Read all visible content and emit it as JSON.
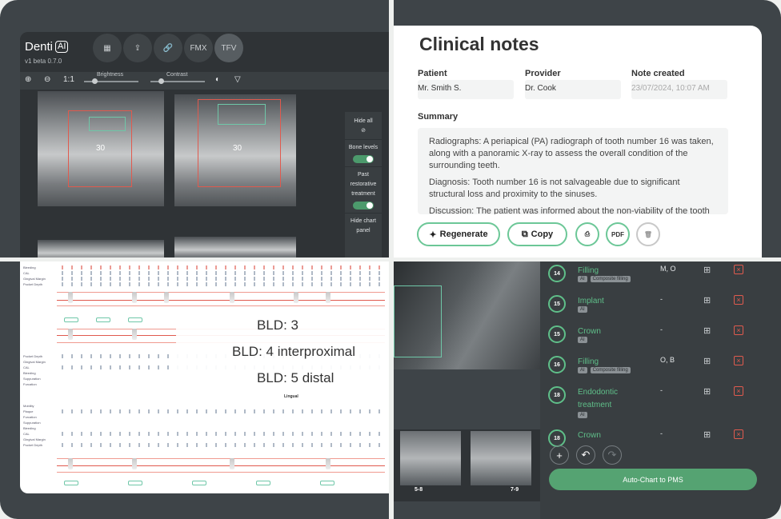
{
  "app": {
    "logo": "Denti",
    "logo_badge": "AI",
    "version": "v1 beta 0.7.0"
  },
  "toolbar": {
    "fmx": "FMX",
    "tfv": "TFV",
    "zoom_in": "⊕",
    "zoom_out": "⊖",
    "one_to_one": "1:1",
    "brightness": "Brightness",
    "contrast": "Contrast"
  },
  "xrays": {
    "label_a": "30",
    "label_b": "30"
  },
  "side_panel": {
    "hide_all": "Hide all",
    "bone_levels": "Bone levels",
    "past_treatment": "Past restorative treatment",
    "hide_chart": "Hide chart panel"
  },
  "notes": {
    "title": "Clinical notes",
    "patient_label": "Patient",
    "patient_value": "Mr. Smith S.",
    "provider_label": "Provider",
    "provider_value": "Dr. Cook",
    "created_label": "Note created",
    "created_value": "23/07/2024, 10:07 AM",
    "summary_label": "Summary",
    "p1": "Radiographs: A periapical (PA) radiograph of tooth number 16 was taken, along with a panoramic X-ray to assess the overall condition of the surrounding teeth.",
    "p2": "Diagnosis: Tooth number 16 is not salvageable due to significant structural loss and proximity to the sinuses.",
    "p3": "Discussion: The patient was informed about the non-viability of the tooth",
    "regenerate": "Regenerate",
    "copy": "Copy",
    "pdf": "PDF"
  },
  "perio": {
    "rows_top": [
      "Bleeding",
      "CAL",
      "Gingival Margin",
      "Pocket Depth"
    ],
    "rows_mid": [
      "Pocket Depth",
      "Gingival Margin",
      "CAL",
      "Bleeding",
      "Suppuration",
      "Furcation"
    ],
    "rows_low": [
      "Mobility",
      "Plaque",
      "Furcation",
      "Suppuration",
      "Bleeding",
      "CAL",
      "Gingival Margin",
      "Pocket Depth"
    ],
    "lingual": "Lingual",
    "bld1": "BLD: 3",
    "bld2": "BLD: 4 interproximal",
    "bld3": "BLD: 5 distal"
  },
  "thumbs": {
    "a": "5-8",
    "b": "7-9"
  },
  "treatments": [
    {
      "tooth": "14",
      "procedure": "Filling",
      "chips": [
        "AI",
        "Composite filling"
      ],
      "surface": "M, O"
    },
    {
      "tooth": "15",
      "procedure": "Implant",
      "chips": [
        "AI"
      ],
      "surface": "-"
    },
    {
      "tooth": "15",
      "procedure": "Crown",
      "chips": [
        "AI"
      ],
      "surface": "-"
    },
    {
      "tooth": "16",
      "procedure": "Filling",
      "chips": [
        "AI",
        "Composite filling"
      ],
      "surface": "O, B"
    },
    {
      "tooth": "18",
      "procedure": "Endodontic treatment",
      "chips": [
        "AI"
      ],
      "surface": "-"
    },
    {
      "tooth": "18",
      "procedure": "Crown",
      "chips": [],
      "surface": "-"
    }
  ],
  "actions": {
    "add": "+",
    "undo": "↶",
    "redo": "↷",
    "auto_chart": "Auto-Chart to PMS"
  },
  "colors": {
    "accent": "#5fbf89",
    "danger": "#e05a4e",
    "panel": "#393e41"
  }
}
